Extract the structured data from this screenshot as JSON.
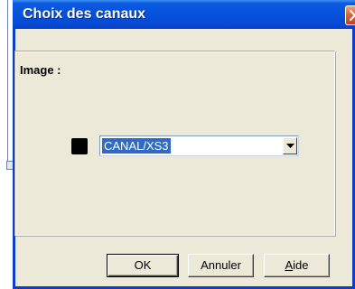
{
  "window": {
    "title": "Choix des canaux"
  },
  "panel": {
    "label": "Image :"
  },
  "channel": {
    "swatch_color": "#000000",
    "selected_value": "CANAL/XS3"
  },
  "buttons": {
    "ok_label": "OK",
    "cancel_label": "Annuler",
    "help_label_first": "A",
    "help_label_rest": "ide"
  },
  "colors": {
    "titlebar": "#0651dd",
    "dialog_bg": "#ece9d8",
    "selection": "#316ac5",
    "close_button": "#e0643c"
  },
  "icons": {
    "close": "close-icon",
    "dropdown": "chevron-down-icon"
  }
}
